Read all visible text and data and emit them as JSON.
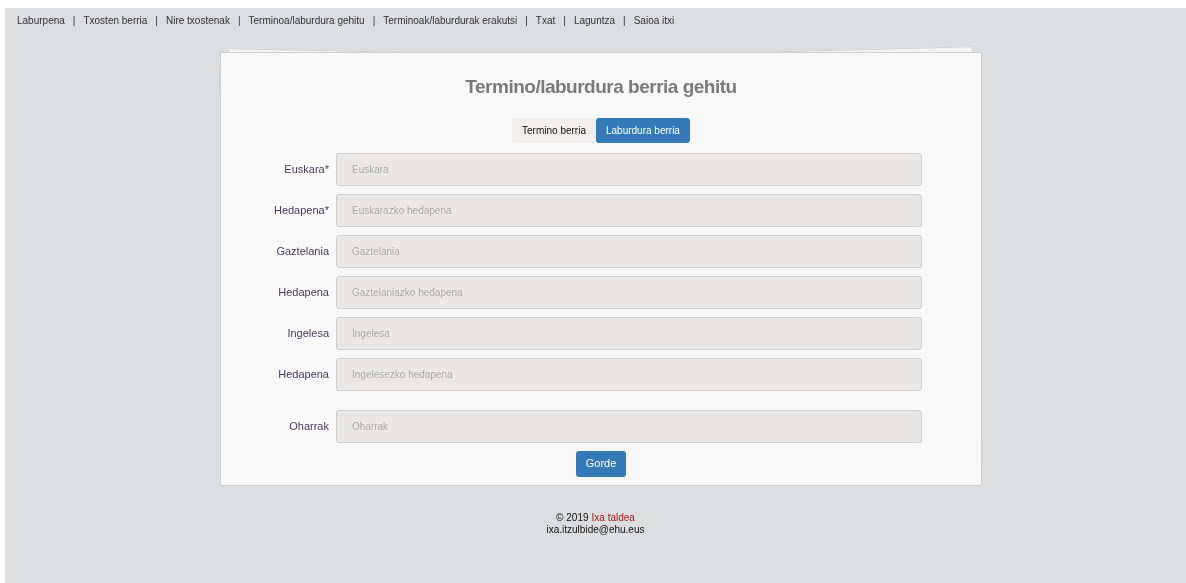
{
  "nav": {
    "items": [
      {
        "label": "Laburpena"
      },
      {
        "label": "Txosten berria"
      },
      {
        "label": "Nire txostenak"
      },
      {
        "label": "Terminoa/laburdura gehitu"
      },
      {
        "label": "Terminoak/laburdurak erakutsi"
      },
      {
        "label": "Txat"
      },
      {
        "label": "Laguntza"
      },
      {
        "label": "Saioa itxi"
      }
    ],
    "separator": "|"
  },
  "form": {
    "title": "Termino/laburdura berria gehitu",
    "tabs": [
      {
        "label": "Termino berria",
        "selected": false
      },
      {
        "label": "Laburdura berria",
        "selected": true
      }
    ],
    "fields": [
      {
        "label": "Euskara*",
        "placeholder": "Euskara"
      },
      {
        "label": "Hedapena*",
        "placeholder": "Euskarazko hedapena"
      },
      {
        "label": "Gaztelania",
        "placeholder": "Gaztelania"
      },
      {
        "label": "Hedapena",
        "placeholder": "Gaztelaniazko hedapena"
      },
      {
        "label": "Ingelesa",
        "placeholder": "Ingelesa"
      },
      {
        "label": "Hedapena",
        "placeholder": "Ingelesezko hedapena"
      }
    ],
    "notes": {
      "label": "Oharrak",
      "placeholder": "Oharrak"
    },
    "submit": "Gorde"
  },
  "footer": {
    "copyright": "© 2019",
    "link": "Ixa taldea",
    "email": "ixa.itzulbide@ehu.eus"
  }
}
